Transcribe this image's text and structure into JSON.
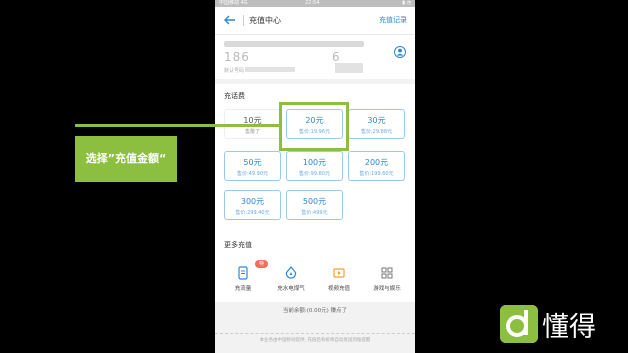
{
  "statusbar": {
    "carrier": "中国移动 4G",
    "time": "22:54",
    "icons": "▮ ◔"
  },
  "nav": {
    "title": "充值中心",
    "record_link": "充值记录"
  },
  "account": {
    "number": "186",
    "number_end": "6",
    "subtext": "默认号码"
  },
  "section": {
    "title": "充话费"
  },
  "options": [
    {
      "amount": "10元",
      "price": "售罄了"
    },
    {
      "amount": "20元",
      "price": "售价:19.96元"
    },
    {
      "amount": "30元",
      "price": "售价:29.88元"
    },
    {
      "amount": "50元",
      "price": "售价:49.90元"
    },
    {
      "amount": "100元",
      "price": "售价:99.80元"
    },
    {
      "amount": "200元",
      "price": "售价:199.60元"
    },
    {
      "amount": "300元",
      "price": "售价:299.40元"
    },
    {
      "amount": "500元",
      "price": "售价:499元"
    }
  ],
  "more": {
    "title": "更多充值",
    "items": [
      {
        "label": "充流量",
        "badge": "特惠"
      },
      {
        "label": "充水电煤气"
      },
      {
        "label": "视频充值"
      },
      {
        "label": "游戏与娱乐"
      }
    ]
  },
  "footer": {
    "balance": "当前余额:(0.00元)  赚点了",
    "note": "本业务由中国移动提供, 充值后系统将自动发送到账提醒"
  },
  "callout": {
    "text": "选择”充值金额“"
  },
  "brand": {
    "name": "懂得"
  },
  "colors": {
    "accent": "#2e86d6",
    "highlight": "#8cbf3f",
    "badge": "#f26d5b"
  }
}
